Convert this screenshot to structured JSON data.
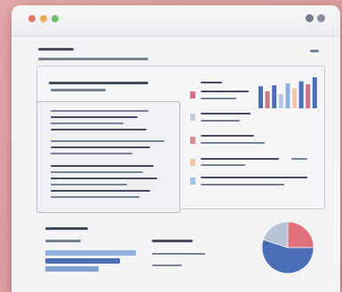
{
  "window": {
    "controls": [
      "close",
      "minimize",
      "maximize"
    ],
    "toolbar_icons": [
      "account-icon",
      "more-icon"
    ]
  },
  "report": {
    "sections": [
      "header",
      "summary-panel",
      "text-panel",
      "legend-list",
      "bar-chart",
      "footer-metrics",
      "pie-chart"
    ]
  },
  "colors": {
    "accent_red": "#e0707c",
    "accent_blue": "#4a6fb8",
    "accent_light_blue": "#8fb2dc",
    "accent_gray": "#b8bfcc"
  },
  "chart_data": [
    {
      "type": "bar",
      "categories": [
        "",
        "",
        "",
        "",
        "",
        "",
        "",
        "",
        ""
      ],
      "values": [
        22,
        17,
        23,
        14,
        25,
        20,
        27,
        24,
        31
      ],
      "colors": [
        "#4a6fb8",
        "#c9738a",
        "#4a6fb8",
        "#b9c3e6",
        "#8fb2dc",
        "#f2c4a8",
        "#4a6fb8",
        "#c9738a",
        "#4a6fb8"
      ],
      "ylim": [
        0,
        32
      ]
    },
    {
      "type": "pie",
      "values": [
        25,
        55,
        20
      ],
      "colors": [
        "#e0707c",
        "#4a6fb8",
        "#b8c4d6"
      ]
    }
  ]
}
